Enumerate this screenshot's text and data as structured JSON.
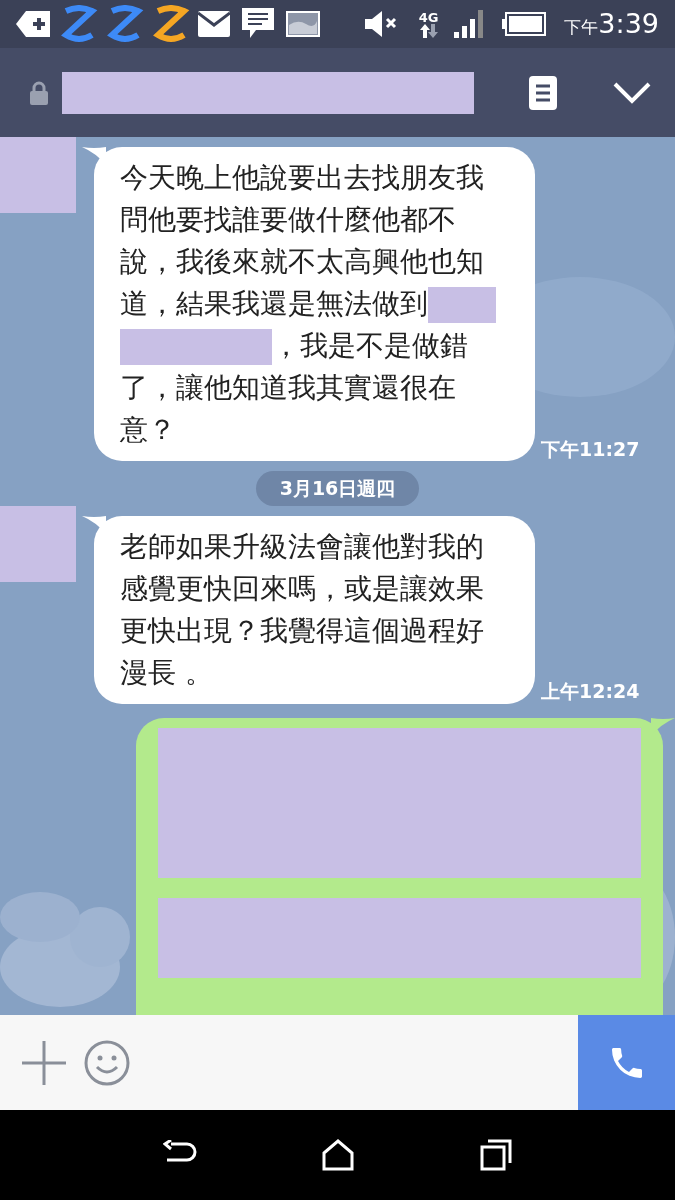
{
  "status_bar": {
    "time_prefix": "下午",
    "time": "3:39",
    "network": "4G"
  },
  "messages": [
    {
      "kind": "incoming",
      "time": "下午11:27",
      "parts": [
        {
          "kind": "text",
          "text": "今天晚上他說要出去找朋友我問他要找誰要做什麼他都不說，我後來就不太高興他也知道，結果我還是無法做到"
        },
        {
          "kind": "redacted"
        },
        {
          "kind": "redacted"
        },
        {
          "kind": "text",
          "text": "，我是不是做錯了，讓他知道我其實還很在意？"
        }
      ]
    },
    {
      "kind": "date",
      "text": "3月16日週四"
    },
    {
      "kind": "incoming",
      "time": "上午12:24",
      "parts": [
        {
          "kind": "text",
          "text": "老師如果升級法會讓他對我的感覺更快回來嗎，或是讓效果更快出現？我覺得這個過程好漫長 。"
        }
      ]
    },
    {
      "kind": "outgoing",
      "parts": [
        {
          "kind": "redacted"
        },
        {
          "kind": "redacted"
        }
      ]
    }
  ]
}
